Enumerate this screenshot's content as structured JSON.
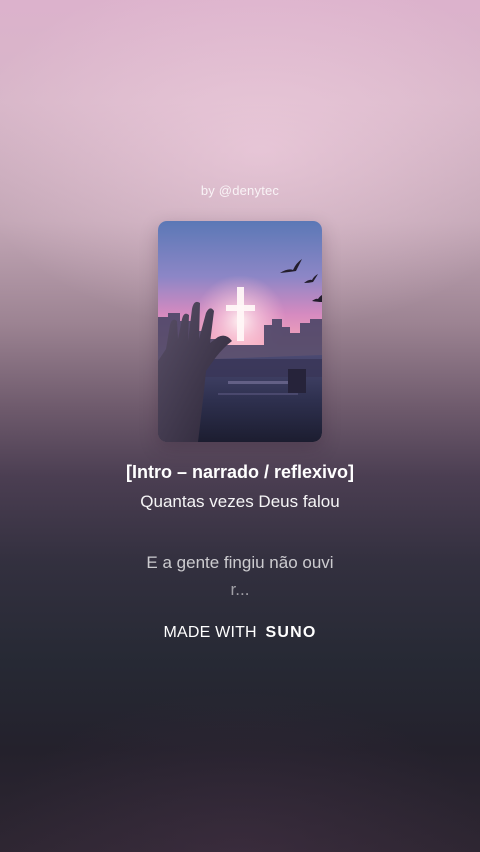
{
  "byline": "by @denytec",
  "cover": {
    "icon": "cover-art-image"
  },
  "lyrics": {
    "section": "[Intro – narrado / reflexivo]",
    "line1": "Quantas vezes Deus falou",
    "line2": "E a gente fingiu não ouvi",
    "line2_cont": "r..."
  },
  "footer": {
    "made_with": "MADE WITH",
    "brand": "SUNO"
  }
}
